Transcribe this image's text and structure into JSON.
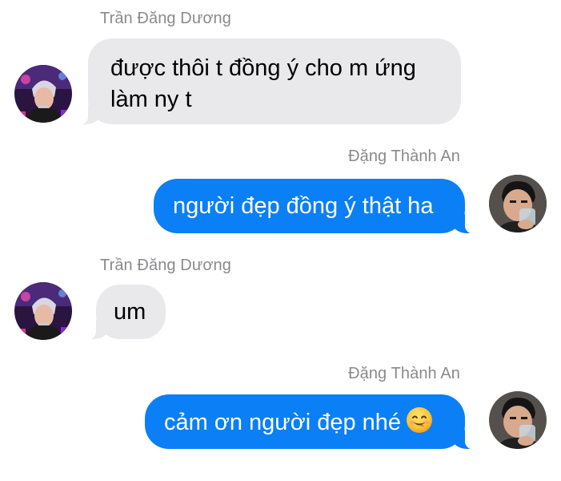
{
  "conversation": {
    "messages": [
      {
        "sender": "Trần Đăng Dương",
        "direction": "incoming",
        "text": "được thôi t đồng ý cho m ứng\nlàm ny t",
        "avatar_icon": "contact-avatar-icon"
      },
      {
        "sender": "Đặng Thành An",
        "direction": "outgoing",
        "text": "người đẹp đồng ý thật ha",
        "avatar_icon": "user-avatar-icon"
      },
      {
        "sender": "Trần Đăng Dương",
        "direction": "incoming",
        "text": "um",
        "avatar_icon": "contact-avatar-icon"
      },
      {
        "sender": "Đặng Thành An",
        "direction": "outgoing",
        "text": "cảm ơn người đẹp nhé",
        "emoji": "smiling-face-emoji",
        "avatar_icon": "user-avatar-icon"
      }
    ]
  },
  "colors": {
    "incoming_bubble": "#e9e9eb",
    "outgoing_bubble": "#0b7ff5",
    "sender_name": "#8a8a8e",
    "background": "#ffffff"
  }
}
